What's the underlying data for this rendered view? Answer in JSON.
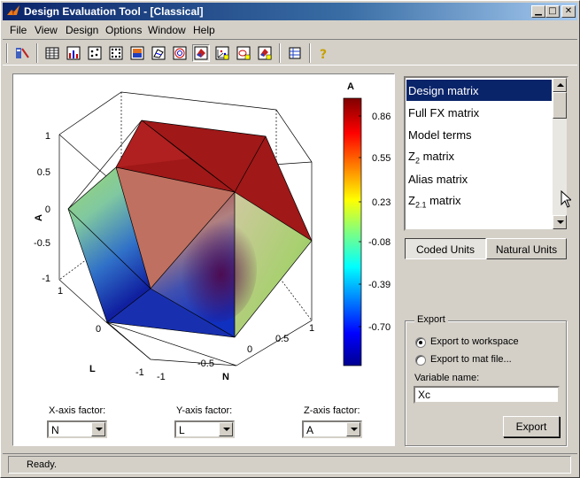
{
  "window": {
    "title": "Design Evaluation Tool - [Classical]"
  },
  "menu": [
    "File",
    "View",
    "Design",
    "Options",
    "Window",
    "Help"
  ],
  "toolbar": {
    "icons": [
      "design-editor-icon",
      "table-icon",
      "bar-chart-icon",
      "scatter-icon",
      "scatter-grid-icon",
      "image-plot-icon",
      "surface-3d-icon",
      "contour-icon",
      "colored-surface-icon",
      "pressed-3d-view-icon",
      "scatter-3d-icon",
      "contour-3d-icon",
      "surface-3d-alt-icon",
      "table-grid-icon",
      "help-icon"
    ]
  },
  "plot": {
    "axis_a_label": "A",
    "axis_l_label": "L",
    "axis_n_label": "N",
    "a_ticks": [
      "1",
      "0.5",
      "0",
      "-0.5",
      "-1"
    ],
    "l_ticks": [
      "1",
      "0",
      "-1"
    ],
    "n_ticks": [
      "-1",
      "-0.5",
      "0",
      "0.5",
      "1"
    ],
    "colorbar_title": "A",
    "colorbar_ticks": [
      "0.86",
      "0.55",
      "0.23",
      "-0.08",
      "-0.39",
      "-0.70"
    ]
  },
  "factors": {
    "x_label": "X-axis factor:",
    "x_value": "N",
    "y_label": "Y-axis factor:",
    "y_value": "L",
    "z_label": "Z-axis factor:",
    "z_value": "A"
  },
  "list": {
    "items": [
      "Design matrix",
      "Full FX matrix",
      "Model terms",
      "Alias matrix"
    ],
    "z2_base": "Z",
    "z2_sub": "2",
    "z2_rest": " matrix",
    "z21_base": "Z",
    "z21_sub": "2.1",
    "z21_rest": " matrix",
    "selected": "Design matrix"
  },
  "units": {
    "coded": "Coded Units",
    "natural": "Natural Units",
    "active": "coded"
  },
  "export": {
    "group_title": "Export",
    "option_workspace": "Export to workspace",
    "option_matfile": "Export to mat file...",
    "selected": "workspace",
    "variable_label": "Variable name:",
    "variable_value": "Xc",
    "button_label": "Export"
  },
  "status": {
    "text": "Ready."
  },
  "colors": {
    "titlebar": "#0a246a",
    "selection": "#0a246a",
    "face": "#d4d0c8"
  }
}
